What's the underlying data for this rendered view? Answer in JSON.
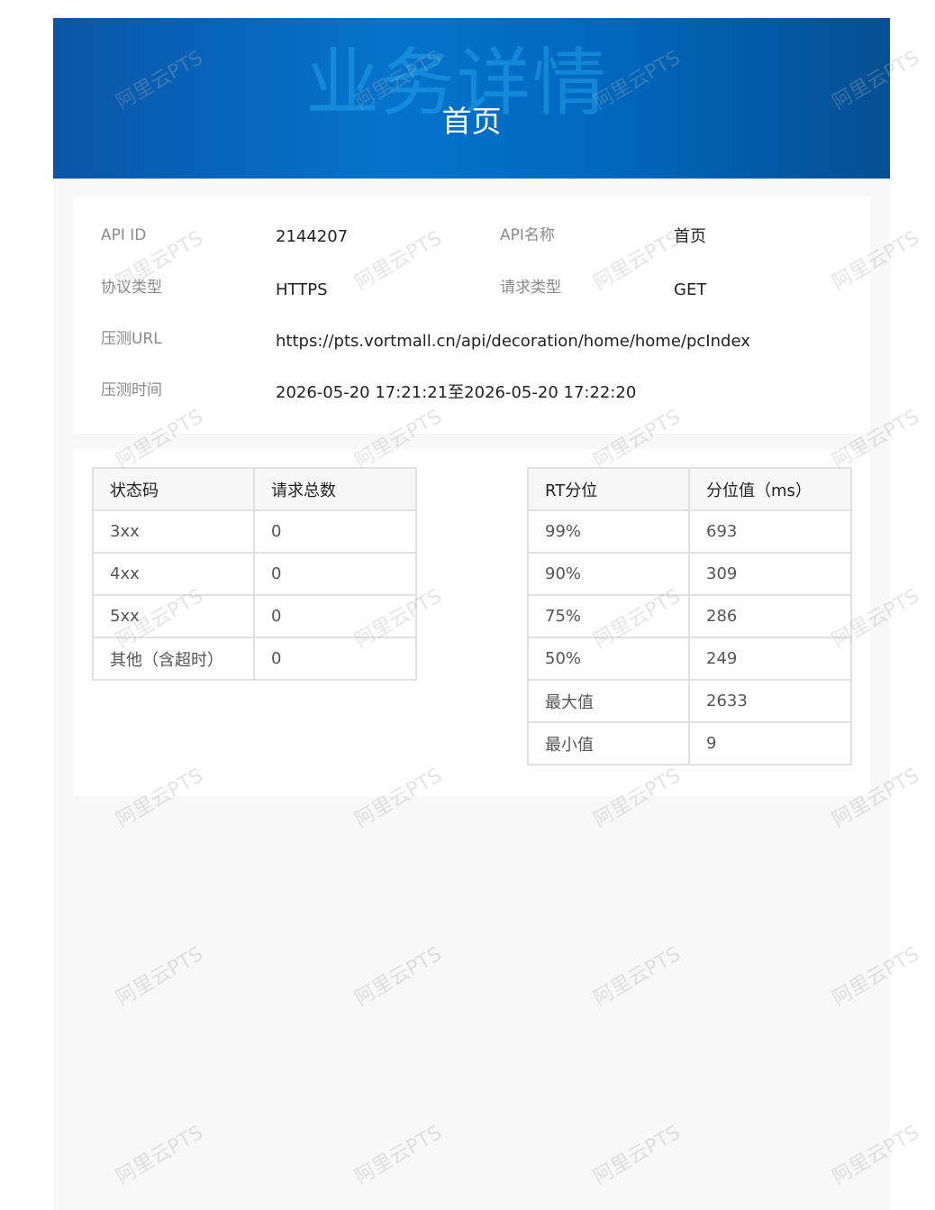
{
  "banner": {
    "background_text": "业务详情",
    "title": "首页"
  },
  "info": {
    "api_id_label": "API ID",
    "api_id_value": "2144207",
    "api_name_label": "API名称",
    "api_name_value": "首页",
    "protocol_label": "协议类型",
    "protocol_value": "HTTPS",
    "method_label": "请求类型",
    "method_value": "GET",
    "url_label": "压测URL",
    "url_value": "https://pts.vortmall.cn/api/decoration/home/home/pcIndex",
    "time_label": "压测时间",
    "time_value": "2026-05-20 17:21:21至2026-05-20 17:22:20"
  },
  "status_table": {
    "headers": [
      "状态码",
      "请求总数"
    ],
    "rows": [
      [
        "3xx",
        "0"
      ],
      [
        "4xx",
        "0"
      ],
      [
        "5xx",
        "0"
      ],
      [
        "其他（含超时）",
        "0"
      ]
    ]
  },
  "rt_table": {
    "headers": [
      "RT分位",
      "分位值（ms）"
    ],
    "rows": [
      [
        "99%",
        "693"
      ],
      [
        "90%",
        "309"
      ],
      [
        "75%",
        "286"
      ],
      [
        "50%",
        "249"
      ],
      [
        "最大值",
        "2633"
      ],
      [
        "最小值",
        "9"
      ]
    ]
  },
  "watermark": {
    "text": "阿里云PTS"
  },
  "colors": {
    "banner_start": "#0a55a8",
    "banner_mid": "#0573cc",
    "banner_end": "#064f93",
    "label": "#8a8a8a",
    "value": "#222222",
    "border": "#e1e1e1"
  }
}
